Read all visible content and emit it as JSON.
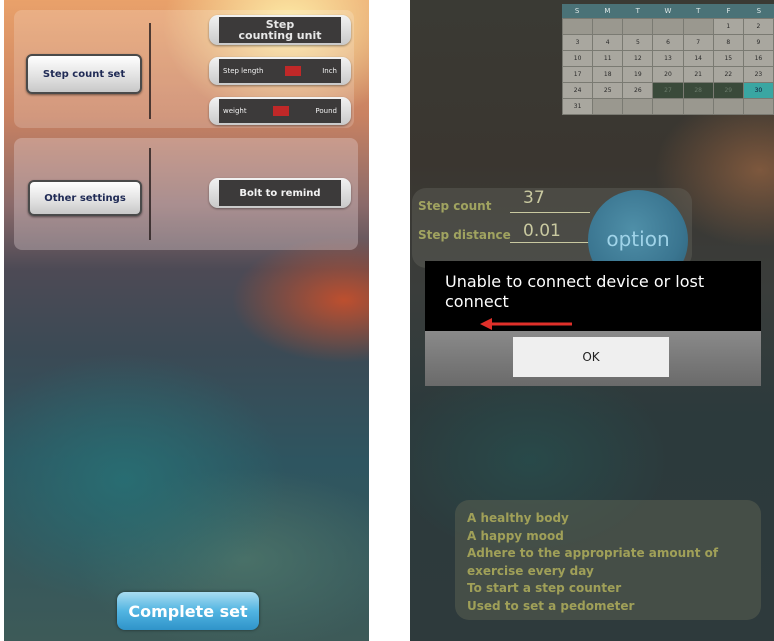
{
  "left_screen": {
    "step_count_set": "Step count set",
    "other_settings": "Other settings",
    "step_counting_unit": [
      "Step",
      "counting unit"
    ],
    "step_length": {
      "label": "Step length",
      "unit": "Inch"
    },
    "weight": {
      "label": "weight",
      "unit": "Pound"
    },
    "bolt_to_remind": "Bolt to remind",
    "complete_set": "Complete set"
  },
  "right_screen": {
    "calendar": {
      "weekdays": [
        "S",
        "M",
        "T",
        "W",
        "T",
        "F",
        "S"
      ],
      "rows": [
        [
          "",
          "",
          "",
          "",
          "",
          "1",
          "2"
        ],
        [
          "3",
          "4",
          "5",
          "6",
          "7",
          "8",
          "9"
        ],
        [
          "10",
          "11",
          "12",
          "13",
          "14",
          "15",
          "16"
        ],
        [
          "17",
          "18",
          "19",
          "20",
          "21",
          "22",
          "23"
        ],
        [
          "24",
          "25",
          "26",
          "27",
          "28",
          "29",
          "30"
        ],
        [
          "31",
          "",
          "",
          "",
          "",
          "",
          ""
        ]
      ]
    },
    "stats": {
      "step_count_label": "Step count",
      "step_count_value": "37",
      "step_distance_label": "Step distance",
      "step_distance_value": "0.01"
    },
    "option_label": "option",
    "dialog": {
      "message": "Unable to connect device or lost connect",
      "ok": "OK"
    },
    "motto": [
      "A healthy body",
      "A happy mood",
      "Adhere to the appropriate amount of",
      "exercise every day",
      "To start a step counter",
      "Used to set a pedometer"
    ]
  },
  "colors": {
    "accent_blue": "#3aa0d8",
    "arrow_red": "#e0302a",
    "label_olive": "#a0a360"
  }
}
